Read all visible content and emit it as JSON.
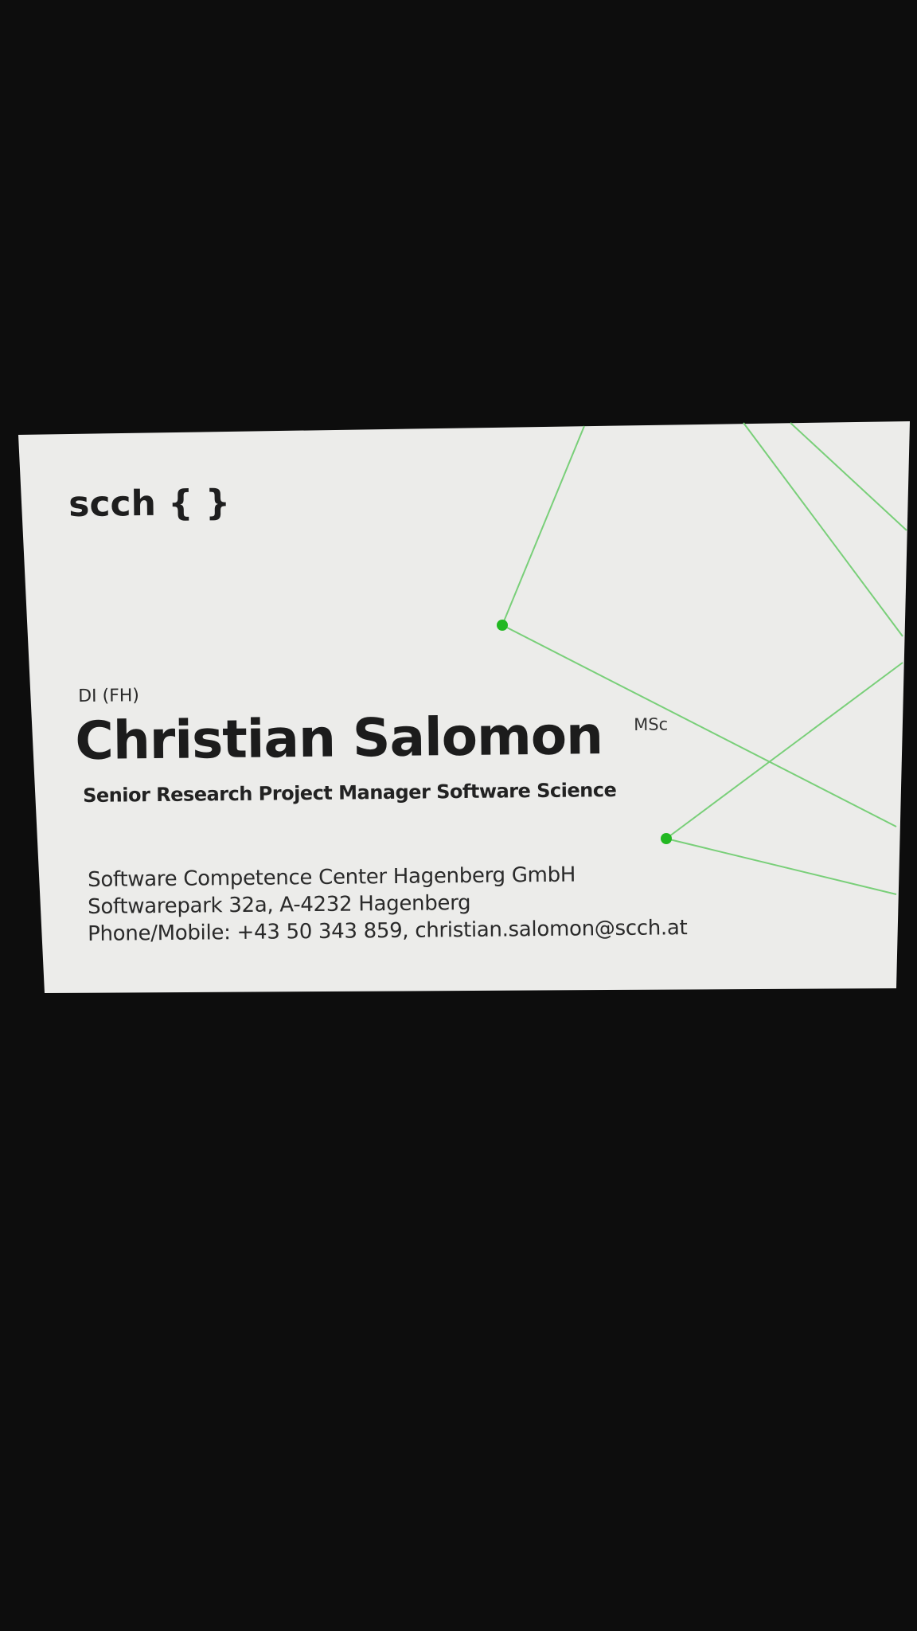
{
  "card": {
    "logo": "scch { }",
    "prefix": "DI (FH)",
    "name": "Christian Salomon",
    "suffix": "MSc",
    "title": "Senior Research Project Manager Software Science",
    "company": "Software Competence Center Hagenberg GmbH",
    "address": "Softwarepark 32a, A-4232 Hagenberg",
    "contact": "Phone/Mobile: +43 50 343 859, christian.salomon@scch.at"
  },
  "colors": {
    "background": "#0d0d0d",
    "card": "#ececea",
    "accent": "#2ec02e",
    "line": "#7fd47f"
  }
}
